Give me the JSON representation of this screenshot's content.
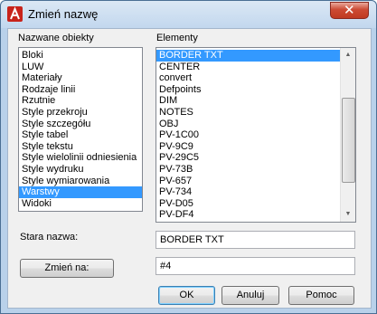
{
  "window": {
    "title": "Zmień nazwę",
    "close_glyph": "✕"
  },
  "named_objects": {
    "label": "Nazwane obiekty",
    "items": [
      "Bloki",
      "LUW",
      "Materiały",
      "Rodzaje linii",
      "Rzutnie",
      "Style przekroju",
      "Style szczegółu",
      "Style tabel",
      "Style tekstu",
      "Style wielolinii odniesienia",
      "Style wydruku",
      "Style wymiarowania",
      "Warstwy",
      "Widoki"
    ],
    "selected": "Warstwy"
  },
  "elements": {
    "label": "Elementy",
    "items": [
      "BORDER TXT",
      "CENTER",
      "convert",
      "Defpoints",
      "DIM",
      "NOTES",
      "OBJ",
      "PV-1C00",
      "PV-9C9",
      "PV-29C5",
      "PV-73B",
      "PV-657",
      "PV-734",
      "PV-D05",
      "PV-DF4"
    ],
    "selected": "BORDER TXT"
  },
  "old_name": {
    "label": "Stara nazwa:",
    "value": "BORDER TXT"
  },
  "rename_to": {
    "button_label": "Zmień na:",
    "value": "#4"
  },
  "buttons": {
    "ok": "OK",
    "cancel": "Anuluj",
    "help": "Pomoc"
  },
  "icons": {
    "app": "autocad-icon",
    "close": "close-icon"
  },
  "colors": {
    "selection": "#3399ff",
    "close_red": "#c03a22",
    "title_bg": "#c2d7ee"
  }
}
